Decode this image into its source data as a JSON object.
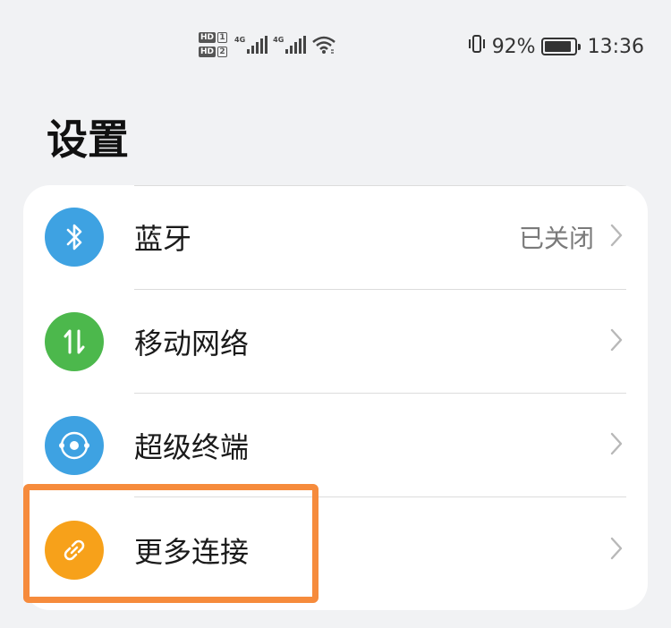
{
  "status_bar": {
    "hd_badge": "HD",
    "sim1": "1",
    "sim2": "2",
    "network1": "4G",
    "network2": "4G",
    "battery_percent_text": "92%",
    "battery_level": 0.92,
    "time": "13:36",
    "icons": [
      "vibrate-icon",
      "wifi-icon",
      "signal-icon",
      "battery-icon"
    ]
  },
  "page": {
    "title": "设置"
  },
  "settings": [
    {
      "label": "蓝牙",
      "status": "已关闭",
      "icon": "bluetooth-icon",
      "color": "#3ea2e2"
    },
    {
      "label": "移动网络",
      "status": "",
      "icon": "mobile-data-icon",
      "color": "#4cb84c"
    },
    {
      "label": "超级终端",
      "status": "",
      "icon": "super-device-icon",
      "color": "#3ea2e2"
    },
    {
      "label": "更多连接",
      "status": "",
      "icon": "link-icon",
      "color": "#f7a11a"
    }
  ],
  "highlight_color": "#f68b3c"
}
